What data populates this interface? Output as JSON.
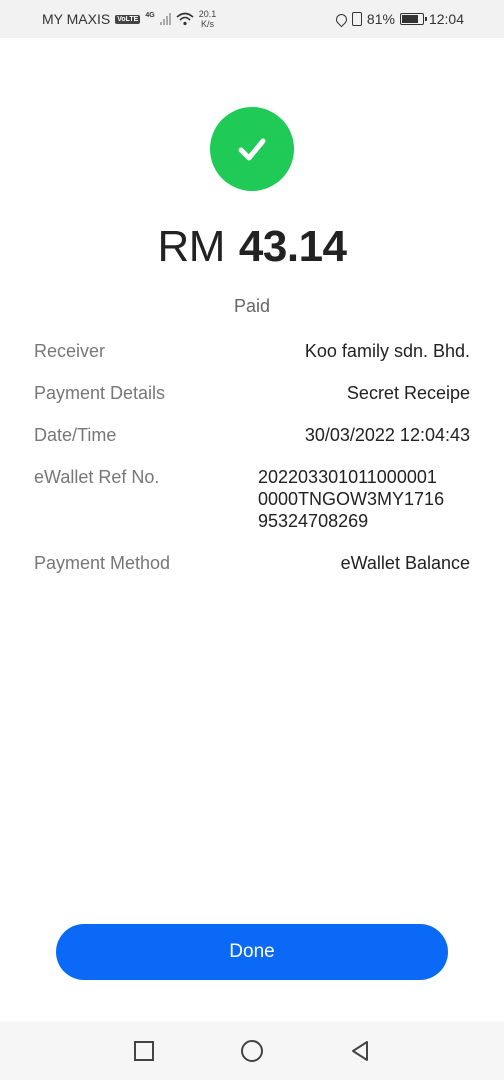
{
  "status_bar": {
    "carrier": "MY MAXIS",
    "volte": "VoLTE",
    "network": "4G",
    "speed_value": "20.1",
    "speed_unit": "K/s",
    "battery": "81%",
    "time": "12:04"
  },
  "receipt": {
    "currency": "RM",
    "amount": "43.14",
    "status": "Paid",
    "rows": [
      {
        "label": "Receiver",
        "value": "Koo family sdn. Bhd."
      },
      {
        "label": "Payment Details",
        "value": "Secret Receipe"
      },
      {
        "label": "Date/Time",
        "value": "30/03/2022 12:04:43"
      },
      {
        "label": "eWallet Ref No.",
        "value": "2022033010110000010000TNGOW3MY171695324708269",
        "lines": [
          "202203301011000001",
          "0000TNGOW3MY1716",
          "95324708269"
        ]
      },
      {
        "label": "Payment Method",
        "value": "eWallet Balance"
      }
    ]
  },
  "actions": {
    "done_label": "Done"
  },
  "colors": {
    "success": "#1fca57",
    "primary": "#0a6af7"
  }
}
